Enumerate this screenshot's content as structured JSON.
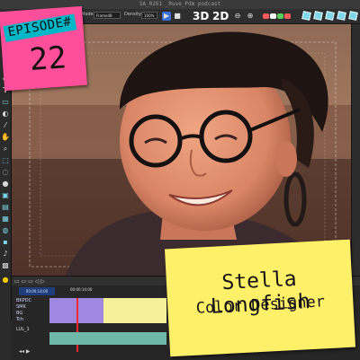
{
  "window": {
    "title": "SA_0261 _Ruve_Pdm podcast"
  },
  "toolbar": {
    "mode_label": "Mode:",
    "mode_value": "Frame48",
    "density_label": "Density:",
    "density_value": "100%",
    "view_3d": "3D",
    "view_2d": "2D",
    "play_icon": "play-icon",
    "stop_icon": "stop-icon",
    "zoom_out_icon": "zoom-out-icon",
    "zoom_in_icon": "zoom-in-icon",
    "swatch_colors": [
      "#ff5a5a",
      "#ffffff",
      "#5ad05a",
      "#ff5a5a"
    ],
    "tile_color": "#7fd6e8"
  },
  "left_tools": [
    "brush-icon",
    "pencil-icon",
    "marker-icon",
    "eraser-icon",
    "shape-icon",
    "text-icon",
    "rectangle-icon",
    "fill-icon",
    "eyedropper-icon",
    "hand-icon",
    "zoom-icon",
    "select-icon",
    "lasso-icon",
    "smudge-icon",
    "stamp-icon",
    "layer-icon",
    "frame-icon",
    "onion-icon",
    "camera-icon",
    "sound-icon",
    "grid-icon"
  ],
  "episode_card": {
    "label": "EPISODE#",
    "number": "22",
    "color_paper": "#ff4f9a",
    "color_band": "#00b7c7"
  },
  "name_card": {
    "name": "Stella Longfish",
    "role": "Color Designer",
    "color_paper": "#fff06a"
  },
  "timeline": {
    "frame_readout": "00:00:14:00",
    "tracks": [
      "BKPDC",
      "SMK",
      "BG",
      "Tch"
    ],
    "audio_label": "LUL_1",
    "clip_colors": {
      "purple": "#a087e0",
      "yellow": "#f4f19a",
      "teal": "#6fb7a8",
      "playhead": "#ff2a2a"
    }
  }
}
